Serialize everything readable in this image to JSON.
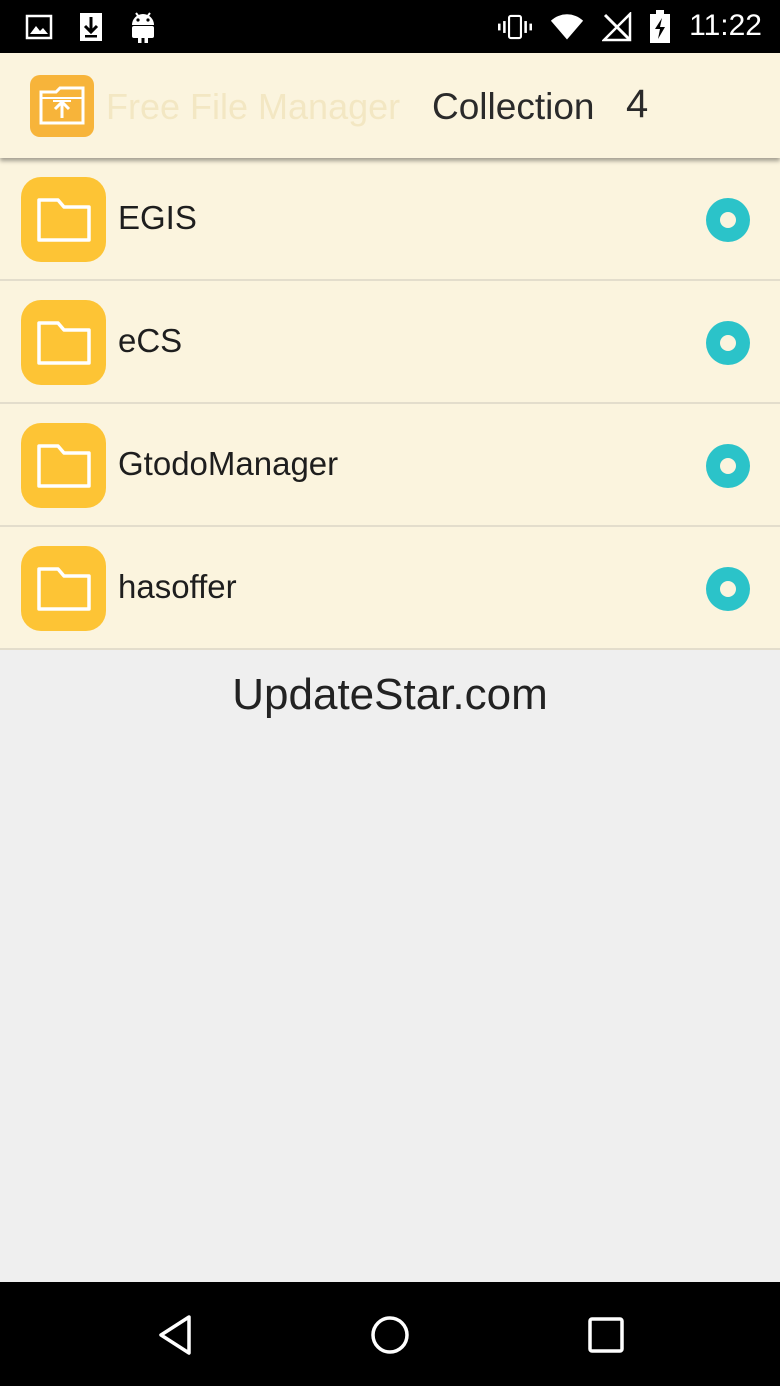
{
  "status_bar": {
    "time": "11:22",
    "left_icons": [
      "image-icon",
      "download-icon",
      "android-icon"
    ],
    "right_icons": [
      "vibrate-icon",
      "wifi-icon",
      "no-signal-icon",
      "battery-charging-icon"
    ]
  },
  "app_bar": {
    "title": "Free File Manager",
    "collection_label": "Collection",
    "collection_count": "4",
    "logo_icon": "folder-upload-icon"
  },
  "folders": [
    {
      "name": "EGIS",
      "selected": true
    },
    {
      "name": "eCS",
      "selected": true
    },
    {
      "name": "GtodoManager",
      "selected": true
    },
    {
      "name": "hasoffer",
      "selected": true
    }
  ],
  "watermark": "UpdateStar.com",
  "nav_bar": {
    "buttons": [
      "back-icon",
      "home-icon",
      "recents-icon"
    ]
  },
  "colors": {
    "accent": "#2bc3c9",
    "folder": "#fdc435",
    "row_background": "#fbf4de",
    "app_logo": "#f7b43a"
  }
}
